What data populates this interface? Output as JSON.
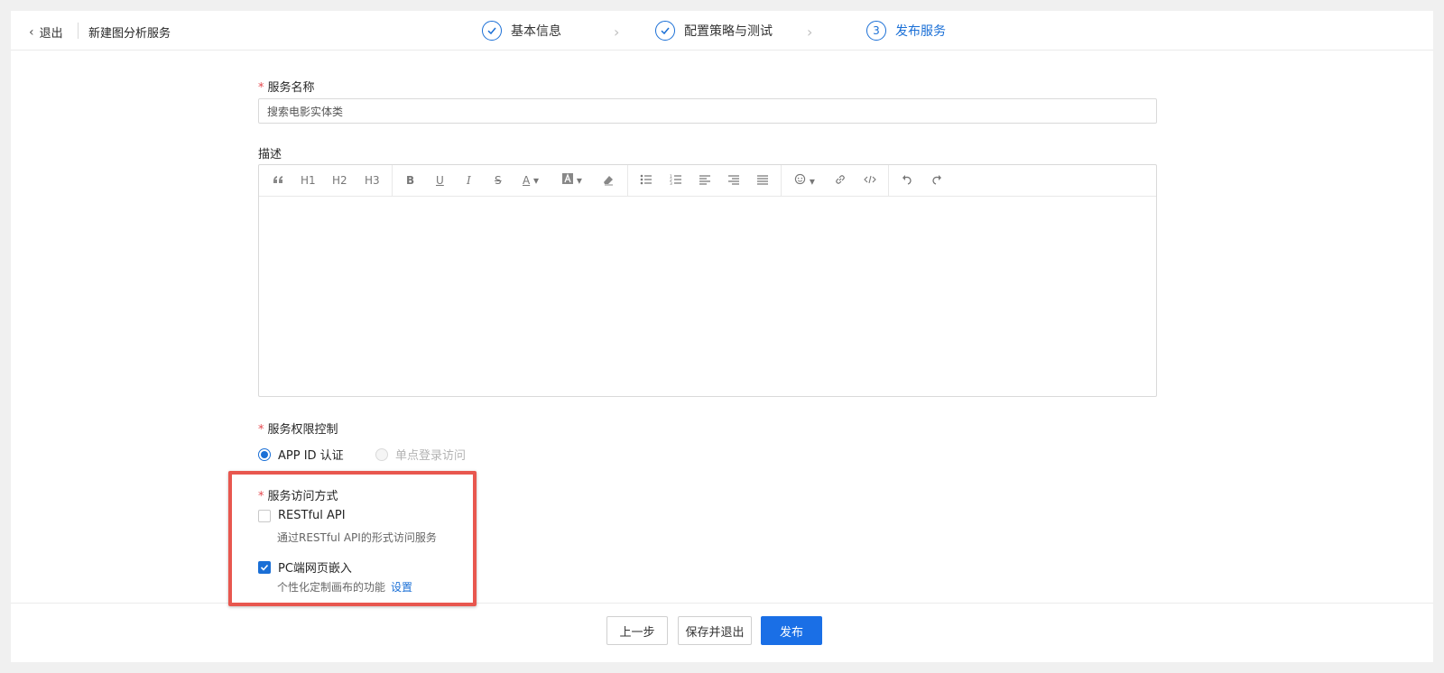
{
  "header": {
    "back_label": "退出",
    "title": "新建图分析服务",
    "steps": [
      {
        "label": "基本信息",
        "status": "done"
      },
      {
        "label": "配置策略与测试",
        "status": "done"
      },
      {
        "label": "发布服务",
        "status": "active",
        "number": "3"
      }
    ]
  },
  "form": {
    "name_label": "服务名称",
    "name_value": "搜索电影实体类",
    "desc_label": "描述",
    "toolbar": {
      "h1": "H1",
      "h2": "H2",
      "h3": "H3",
      "bold": "B",
      "underline": "U",
      "italic": "I",
      "strike": "S",
      "font_color": "A"
    },
    "auth_label": "服务权限控制",
    "auth_options": [
      {
        "label": "APP ID 认证",
        "selected": true,
        "disabled": false
      },
      {
        "label": "单点登录访问",
        "selected": false,
        "disabled": true
      }
    ],
    "access_label": "服务访问方式",
    "access_options": [
      {
        "label": "RESTful API",
        "desc": "通过RESTful API的形式访问服务",
        "checked": false
      },
      {
        "label": "PC端网页嵌入",
        "desc": "个性化定制画布的功能",
        "checked": true,
        "link": "设置"
      }
    ]
  },
  "footer": {
    "prev_label": "上一步",
    "save_label": "保存并退出",
    "publish_label": "发布"
  },
  "colors": {
    "accent": "#1a6fd6",
    "required": "#e5484d",
    "highlight_box": "#e8574f"
  }
}
